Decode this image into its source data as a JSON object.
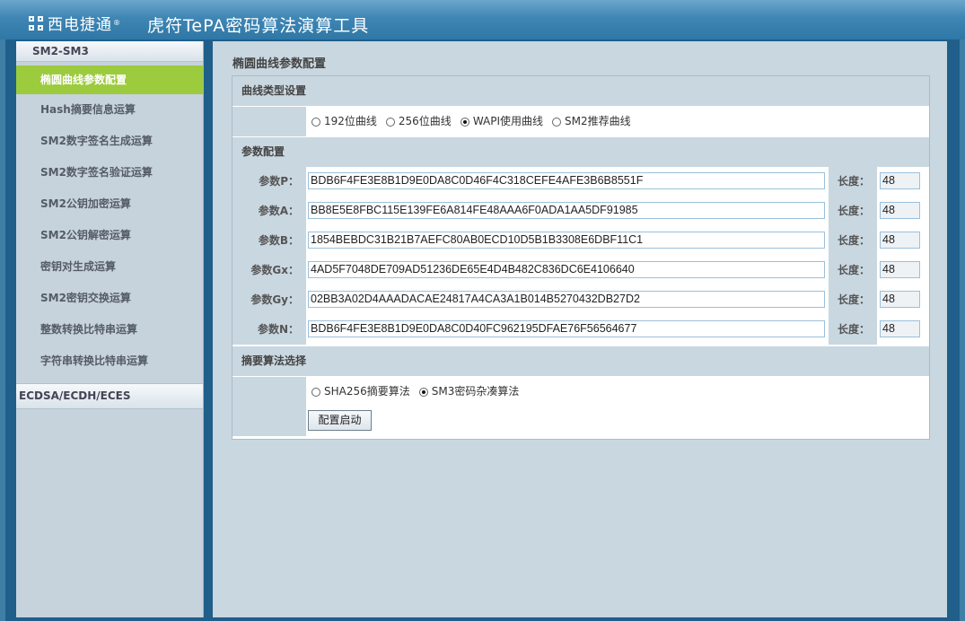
{
  "header": {
    "brand": "西电捷通",
    "trademark": "®",
    "app_title": "虎符TePA密码算法演算工具"
  },
  "sidebar": {
    "group1": "SM2-SM3",
    "items": [
      {
        "label": "椭圆曲线参数配置",
        "active": true
      },
      {
        "label": "Hash摘要信息运算"
      },
      {
        "label": "SM2数字签名生成运算"
      },
      {
        "label": "SM2数字签名验证运算"
      },
      {
        "label": "SM2公钥加密运算"
      },
      {
        "label": "SM2公钥解密运算"
      },
      {
        "label": "密钥对生成运算"
      },
      {
        "label": "SM2密钥交换运算"
      },
      {
        "label": "整数转换比特串运算"
      },
      {
        "label": "字符串转换比特串运算"
      }
    ],
    "group2": "ECDSA/ECDH/ECES"
  },
  "main": {
    "page_title": "椭圆曲线参数配置",
    "curve_section": "曲线类型设置",
    "curve_options": [
      {
        "label": "192位曲线",
        "checked": false
      },
      {
        "label": "256位曲线",
        "checked": false
      },
      {
        "label": "WAPI使用曲线",
        "checked": true
      },
      {
        "label": "SM2推荐曲线",
        "checked": false
      }
    ],
    "param_section": "参数配置",
    "length_label": "长度：",
    "params": [
      {
        "label": "参数P：",
        "value": "BDB6F4FE3E8B1D9E0DA8C0D46F4C318CEFE4AFE3B6B8551F",
        "length": "48"
      },
      {
        "label": "参数A：",
        "value": "BB8E5E8FBC115E139FE6A814FE48AAA6F0ADA1AA5DF91985",
        "length": "48"
      },
      {
        "label": "参数B：",
        "value": "1854BEBDC31B21B7AEFC80AB0ECD10D5B1B3308E6DBF11C1",
        "length": "48"
      },
      {
        "label": "参数Gx：",
        "value": "4AD5F7048DE709AD51236DE65E4D4B482C836DC6E4106640",
        "length": "48"
      },
      {
        "label": "参数Gy：",
        "value": "02BB3A02D4AAADACAE24817A4CA3A1B014B5270432DB27D2",
        "length": "48"
      },
      {
        "label": "参数N：",
        "value": "BDB6F4FE3E8B1D9E0DA8C0D40FC962195DFAE76F56564677",
        "length": "48"
      }
    ],
    "hash_section": "摘要算法选择",
    "hash_options": [
      {
        "label": "SHA256摘要算法",
        "checked": false
      },
      {
        "label": "SM3密码杂凑算法",
        "checked": true
      }
    ],
    "start_button": "配置启动"
  }
}
